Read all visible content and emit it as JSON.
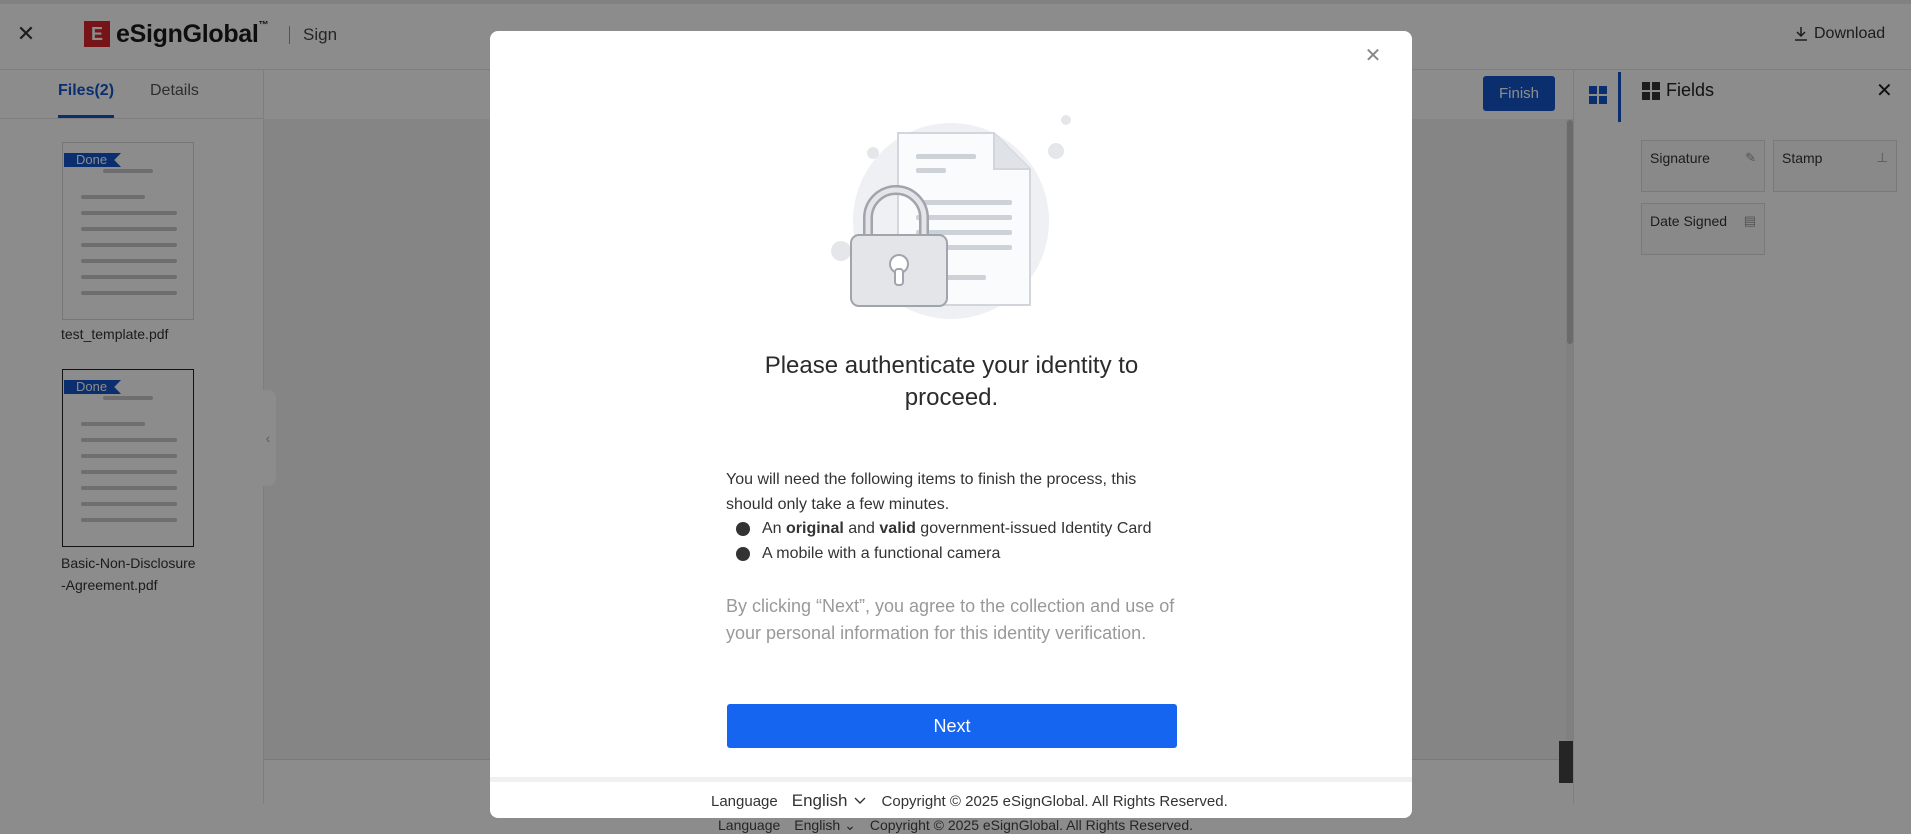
{
  "header": {
    "brand": "eSignGlobal",
    "brand_tm": "™",
    "logo_mark": "E",
    "section": "Sign",
    "download_label": "Download"
  },
  "left_panel": {
    "tabs": [
      {
        "label": "Files(2)",
        "active": true
      },
      {
        "label": "Details",
        "active": false
      }
    ],
    "files": [
      {
        "name": "test_template.pdf",
        "status": "Done",
        "selected": false
      },
      {
        "name": "Basic-Non-Disclosure-Agreement.pdf",
        "name_line1": "Basic-Non-Disclosure",
        "name_line2": "-Agreement.pdf",
        "status": "Done",
        "selected": true
      }
    ]
  },
  "toolbar": {
    "finish_label": "Finish"
  },
  "fields_panel": {
    "title": "Fields",
    "items": [
      {
        "label": "Signature",
        "icon": "pen-icon"
      },
      {
        "label": "Stamp",
        "icon": "stamp-icon"
      },
      {
        "label": "Date Signed",
        "icon": "calendar-icon"
      }
    ]
  },
  "footer": {
    "language_label": "Language",
    "language_value": "English",
    "copyright": "Copyright © 2025 eSignGlobal. All Rights Reserved."
  },
  "modal": {
    "title": "Please authenticate your identity to proceed.",
    "intro": "You will need the following items to finish the process, this should only take a few minutes.",
    "requirement1": {
      "prefix": "An ",
      "bold1": "original",
      "middle": " and ",
      "bold2": "valid",
      "suffix": " government-issued Identity Card"
    },
    "requirement2": "A mobile with a functional camera",
    "consent": "By clicking “Next”, you agree to the collection and use of your personal information for this identity verification.",
    "next_label": "Next",
    "language_label": "Language",
    "language_value": "English",
    "copyright": "Copyright © 2025 eSignGlobal. All Rights Reserved."
  },
  "colors": {
    "brand_blue": "#1556c9",
    "next_blue": "#1665f0",
    "logo_red": "#d9262b"
  }
}
